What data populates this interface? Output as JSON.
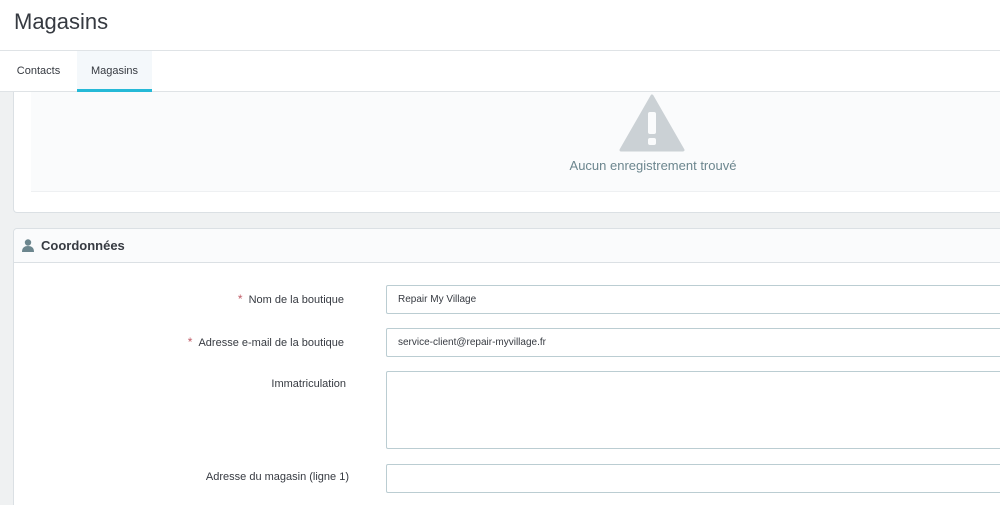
{
  "header": {
    "title": "Magasins"
  },
  "tabs": [
    {
      "label": "Contacts",
      "active": false
    },
    {
      "label": "Magasins",
      "active": true
    }
  ],
  "empty_state": {
    "message": "Aucun enregistrement trouvé",
    "icon": "warning-icon"
  },
  "form": {
    "title": "Coordonnées",
    "icon": "user-icon",
    "fields": [
      {
        "label": "Nom de la boutique",
        "required": true,
        "value": "Repair My Village"
      },
      {
        "label": "Adresse e-mail de la boutique",
        "required": true,
        "value": "service-client@repair-myvillage.fr"
      },
      {
        "label": "Immatriculation",
        "required": false,
        "value": ""
      },
      {
        "label": "Adresse du magasin (ligne 1)",
        "required": false,
        "value": ""
      }
    ]
  },
  "colors": {
    "accent": "#25b9d7",
    "required": "#c05c67",
    "icon_gray": "#cbd1d5"
  }
}
